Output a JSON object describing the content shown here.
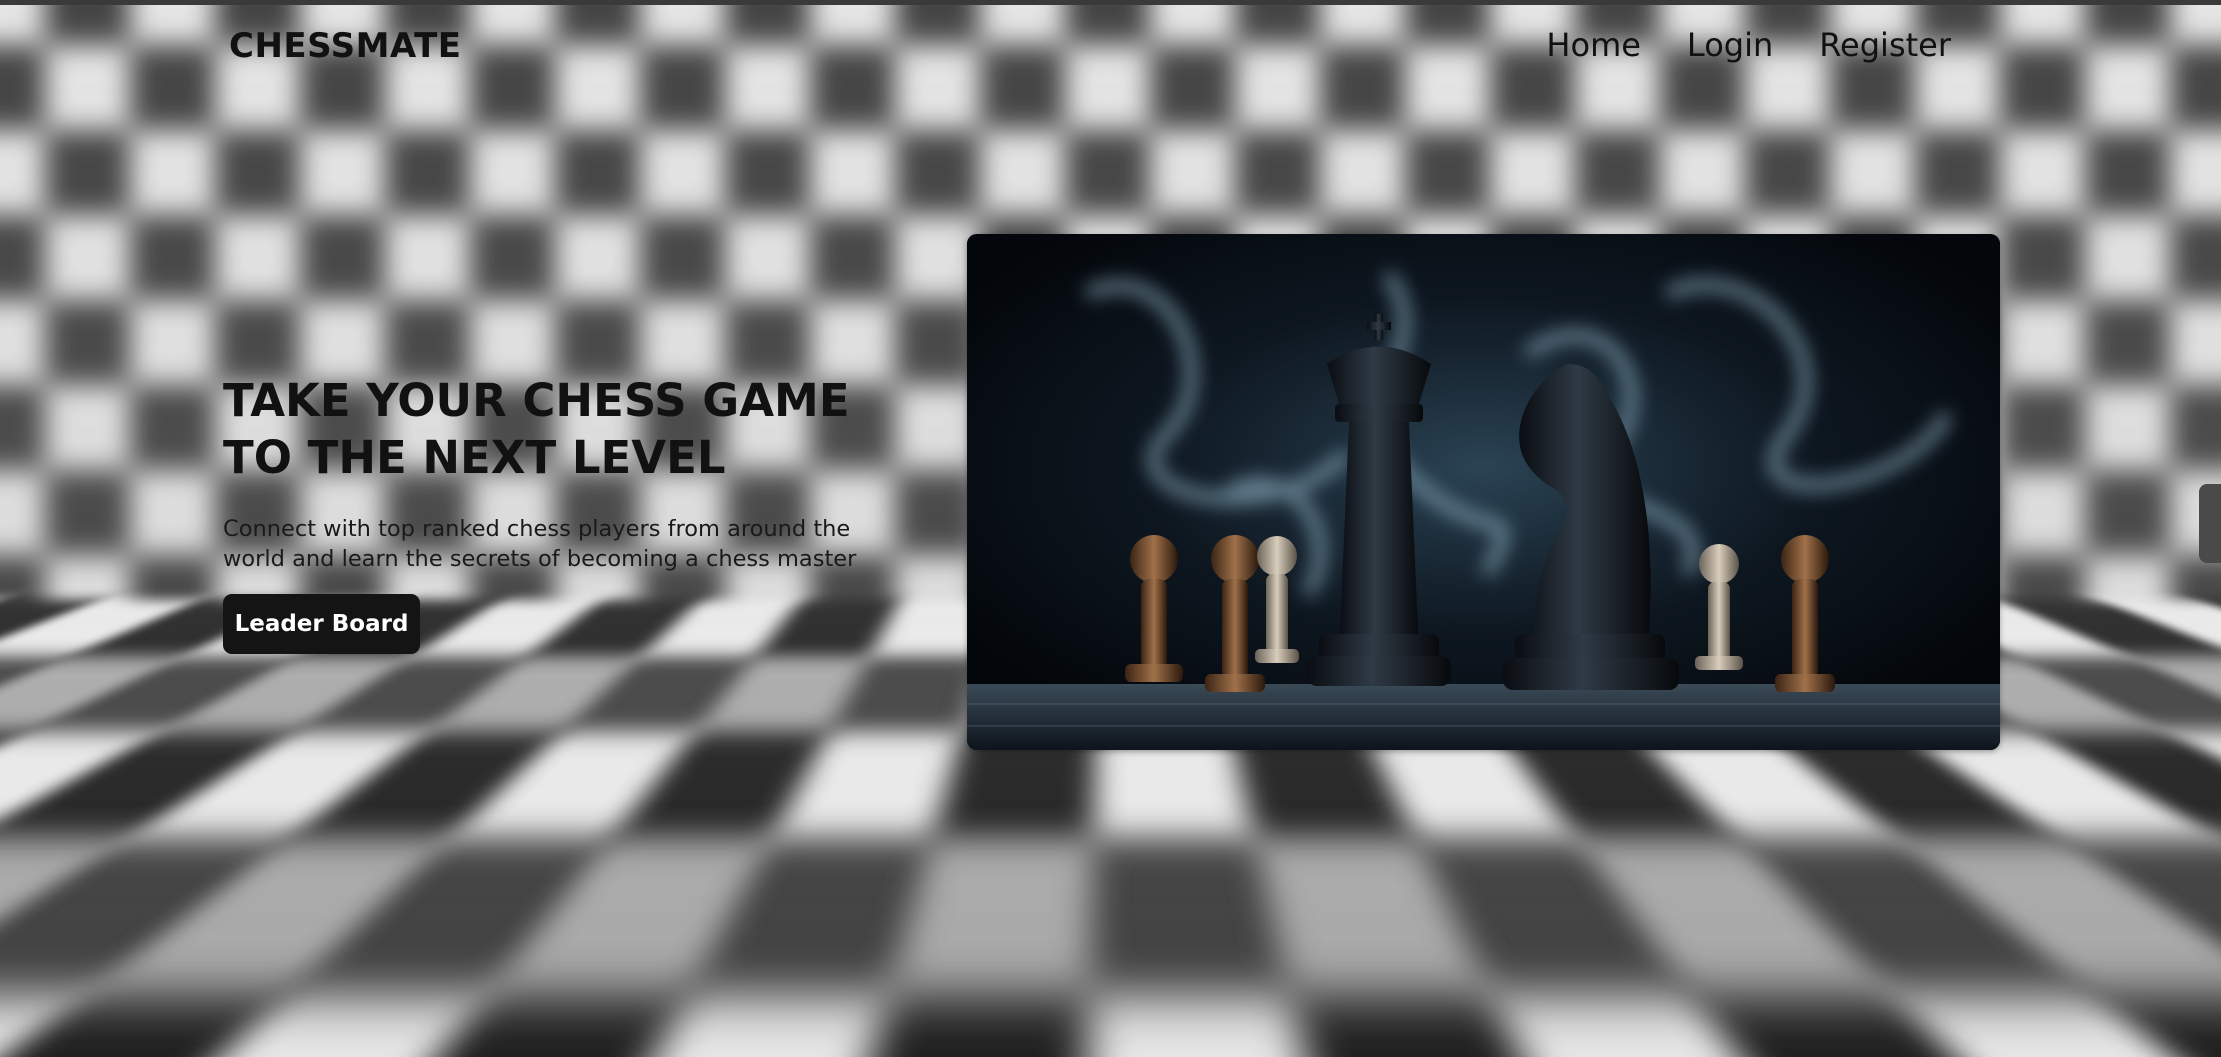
{
  "nav": {
    "brand": "CHESSMATE",
    "links": [
      {
        "label": "Home"
      },
      {
        "label": "Login"
      },
      {
        "label": "Register"
      }
    ]
  },
  "hero": {
    "title": "TAKE YOUR CHESS GAME\nTO THE NEXT LEVEL",
    "subtitle": "Connect with top ranked chess players from around the\nworld and learn the secrets of becoming a chess master",
    "cta_label": "Leader Board",
    "image_subject": "chess pieces on a board in smoke"
  },
  "colors": {
    "button_bg": "#141414",
    "button_text": "#ffffff",
    "text": "#111111"
  }
}
